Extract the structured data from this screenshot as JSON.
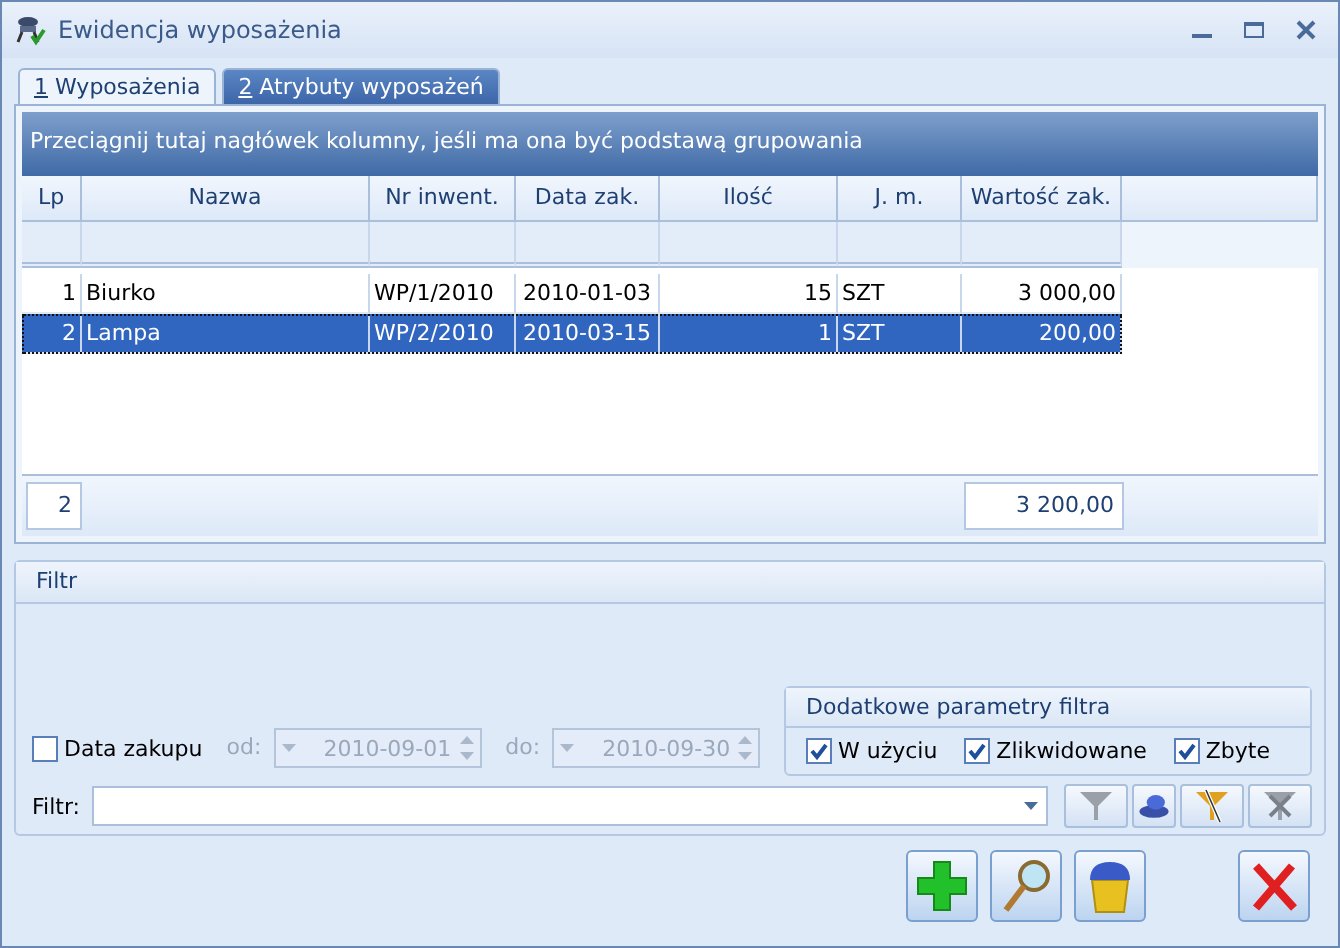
{
  "window": {
    "title": "Ewidencja wyposażenia"
  },
  "tabs": [
    {
      "key": "1",
      "label": "Wyposażenia",
      "selected": true
    },
    {
      "key": "2",
      "label": "Atrybuty wyposażeń",
      "selected": false
    }
  ],
  "grid": {
    "group_hint": "Przeciągnij tutaj nagłówek kolumny, jeśli ma ona być podstawą grupowania",
    "columns": [
      "Lp",
      "Nazwa",
      "Nr inwent.",
      "Data zak.",
      "Ilość",
      "J. m.",
      "Wartość zak."
    ],
    "rows": [
      {
        "cells": [
          "1",
          "Biurko",
          "WP/1/2010",
          "2010-01-03",
          "15",
          "SZT",
          "3 000,00"
        ],
        "selected": false
      },
      {
        "cells": [
          "2",
          "Lampa",
          "WP/2/2010",
          "2010-03-15",
          "1",
          "SZT",
          "200,00"
        ],
        "selected": true
      }
    ],
    "footer": {
      "count": "2",
      "total": "3 200,00"
    }
  },
  "filter": {
    "title": "Filtr",
    "date": {
      "label": "Data zakupu",
      "checked": false,
      "from_label": "od:",
      "from": "2010-09-01",
      "to_label": "do:",
      "to": "2010-09-30",
      "disabled": true
    },
    "extra": {
      "title": "Dodatkowe parametry filtra",
      "options": [
        {
          "label": "W użyciu",
          "checked": true
        },
        {
          "label": "Zlikwidowane",
          "checked": true
        },
        {
          "label": "Zbyte",
          "checked": true
        }
      ]
    },
    "field_label": "Filtr:"
  }
}
